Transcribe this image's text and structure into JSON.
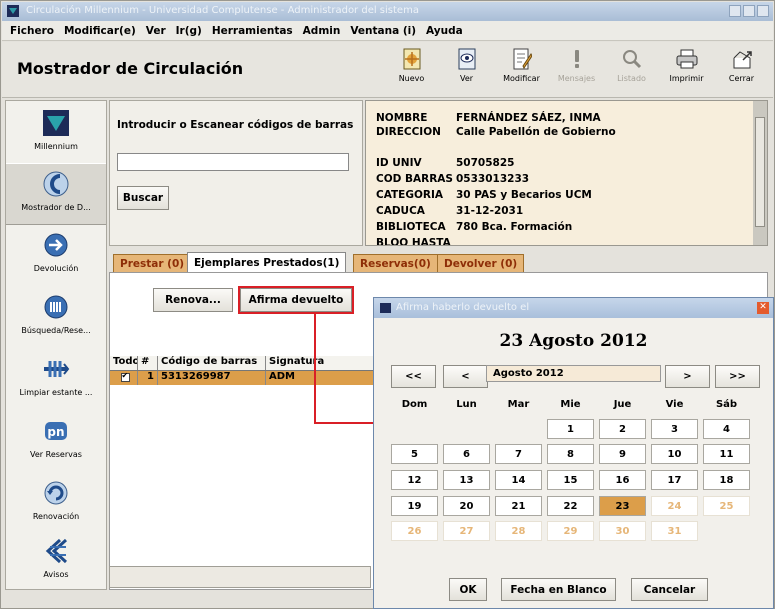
{
  "window": {
    "title": "Circulación Millennium - Universidad Complutense - Administrador del sistema"
  },
  "menu": [
    "Fichero",
    "Modificar(e)",
    "Ver",
    "Ir(g)",
    "Herramientas",
    "Admin",
    "Ventana (i)",
    "Ayuda"
  ],
  "header": {
    "title": "Mostrador de Circulación",
    "toolbar": [
      {
        "label": "Nuevo",
        "icon": "new-icon",
        "enabled": true
      },
      {
        "label": "Ver",
        "icon": "view-icon",
        "enabled": true
      },
      {
        "label": "Modificar",
        "icon": "edit-icon",
        "enabled": true
      },
      {
        "label": "Mensajes",
        "icon": "messages-icon",
        "enabled": false
      },
      {
        "label": "Listado",
        "icon": "list-icon",
        "enabled": false
      },
      {
        "label": "Imprimir",
        "icon": "print-icon",
        "enabled": true
      },
      {
        "label": "Cerrar",
        "icon": "close-icon",
        "enabled": true
      }
    ]
  },
  "sidebar": {
    "items": [
      {
        "label": "Millennium",
        "icon": "millennium-logo-icon"
      },
      {
        "label": "Mostrador de D...",
        "icon": "circulation-desk-icon"
      },
      {
        "label": "Devolución",
        "icon": "return-icon"
      },
      {
        "label": "Búsqueda/Rese...",
        "icon": "search-reserve-icon"
      },
      {
        "label": "Limpiar estante ...",
        "icon": "clear-shelf-icon"
      },
      {
        "label": "Ver Reservas",
        "icon": "view-reserves-icon"
      },
      {
        "label": "Renovación",
        "icon": "renewal-icon"
      },
      {
        "label": "Avisos",
        "icon": "notices-icon"
      }
    ]
  },
  "barcode": {
    "prompt": "Introducir o Escanear códigos de barras",
    "value": "",
    "search_button": "Buscar"
  },
  "patron": {
    "fields": [
      {
        "key": "NOMBRE",
        "value": "FERNÁNDEZ SÁEZ, INMA"
      },
      {
        "key": "DIRECCION",
        "value": "Calle  Pabellón de Gobierno"
      },
      {
        "key": "ID UNIV",
        "value": "50705825"
      },
      {
        "key": "COD BARRAS",
        "value": "0533013233"
      },
      {
        "key": "CATEGORIA",
        "value": "30 PAS y Becarios UCM"
      },
      {
        "key": "CADUCA",
        "value": "31-12-2031"
      },
      {
        "key": "BIBLIOTECA",
        "value": "780  Bca. Formación"
      },
      {
        "key": "BLOQ HASTA",
        "value": ""
      }
    ]
  },
  "tabs": [
    {
      "label": "Prestar (0)",
      "active": false
    },
    {
      "label": "Ejemplares Prestados(1)",
      "active": true
    },
    {
      "label": "Reservas(0)",
      "active": false
    },
    {
      "label": "Devolver (0)",
      "active": false
    }
  ],
  "actions": {
    "renew_label": "Renova...",
    "confirm_return_label": "Afirma devuelto"
  },
  "loans_table": {
    "headers": [
      "Todo",
      "#",
      "Código de barras",
      "Signatura"
    ],
    "rows": [
      {
        "checked": true,
        "num": "1",
        "barcode": "5313269987",
        "call_number": "ADM"
      }
    ]
  },
  "dialog": {
    "title": "Afirma haberlo devuelto el",
    "selected_date": "23 Agosto 2012",
    "nav": {
      "prev_year": "<<",
      "prev_month": "<",
      "month_field": "Agosto 2012",
      "next_month": ">",
      "next_year": ">>"
    },
    "weekdays": [
      "Dom",
      "Lun",
      "Mar",
      "Mie",
      "Jue",
      "Vie",
      "Sáb"
    ],
    "weeks": [
      [
        "",
        "",
        "",
        "1",
        "2",
        "3",
        "4"
      ],
      [
        "5",
        "6",
        "7",
        "8",
        "9",
        "10",
        "11"
      ],
      [
        "12",
        "13",
        "14",
        "15",
        "16",
        "17",
        "18"
      ],
      [
        "19",
        "20",
        "21",
        "22",
        "23",
        "24",
        "25"
      ],
      [
        "26",
        "27",
        "28",
        "29",
        "30",
        "31",
        ""
      ]
    ],
    "selected_day": "23",
    "ok_label": "OK",
    "blank_label": "Fecha en Blanco",
    "cancel_label": "Cancelar"
  },
  "colors": {
    "accent_orange": "#dc9e4a",
    "tab_orange": "#e6b678",
    "patron_bg": "#f7eedc",
    "annotation_red": "#d91f26",
    "titlebar_blue": "#a9bdd6"
  }
}
